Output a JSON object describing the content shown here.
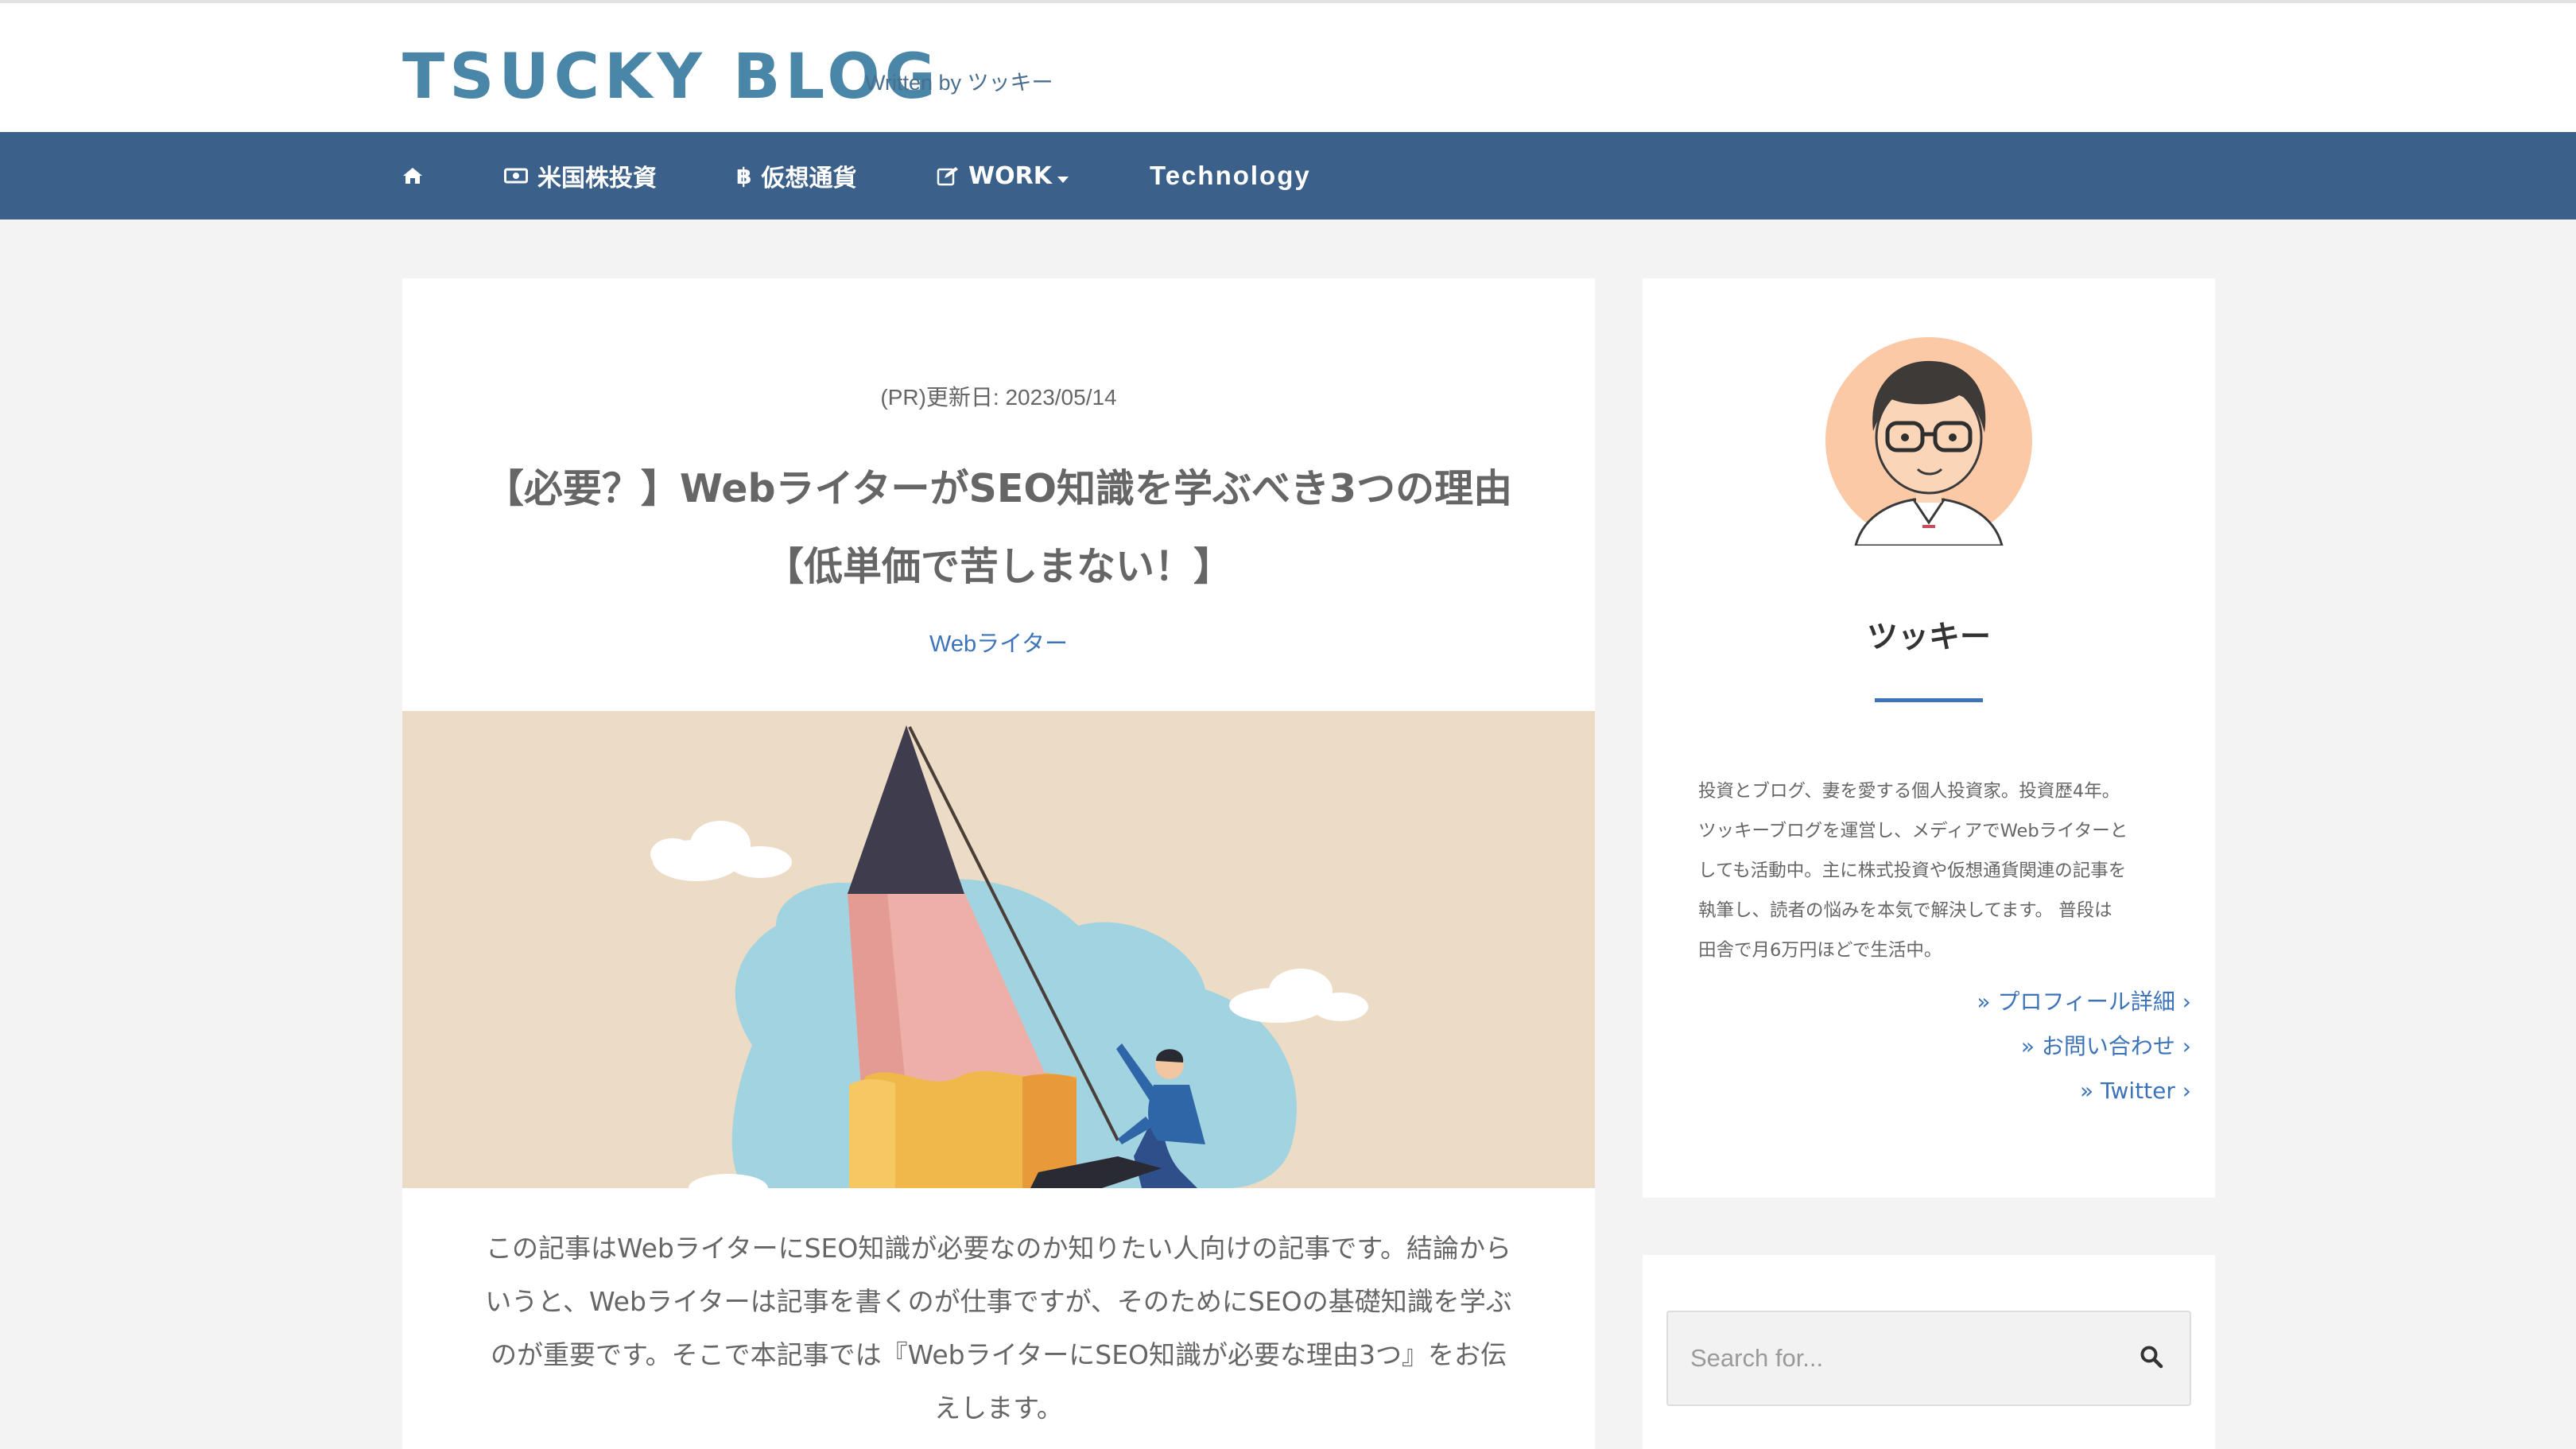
{
  "site": {
    "title": "TSUCKY BLOG",
    "tagline": "Written by ツッキー"
  },
  "nav": {
    "items": [
      {
        "icon": "home-icon",
        "label": ""
      },
      {
        "icon": "money-icon",
        "label": "米国株投資"
      },
      {
        "icon": "bitcoin-icon",
        "label": "仮想通貨"
      },
      {
        "icon": "edit-icon",
        "label": "WORK",
        "dropdown": true
      },
      {
        "icon": "",
        "label": "Technology"
      }
    ]
  },
  "post": {
    "meta": "(PR)更新日: 2023/05/14",
    "title_line1": "【必要？】WebライターがSEO知識を学ぶべき3つの理由",
    "title_line2": "【低単価で苦しまない！】",
    "category": "Webライター",
    "intro_lines": [
      "この記事はWebライターにSEO知識が必要なのか知りたい人向けの記事です。結論から",
      "いうと、Webライターは記事を書くのが仕事ですが、そのためにSEOの基礎知識を学ぶ",
      "のが重要です。そこで本記事では『WebライターにSEO知識が必要な理由3つ』をお伝",
      "えします。"
    ]
  },
  "profile": {
    "name": "ツッキー",
    "description_lines": [
      "投資とブログ、妻を愛する個人投資家。投資歴4年。",
      "ツッキーブログを運営し、メディアでWebライターと",
      "しても活動中。主に株式投資や仮想通貨関連の記事を",
      "執筆し、読者の悩みを本気で解決してます。 普段は",
      "田舎で月6万円ほどで生活中。"
    ],
    "links": [
      {
        "label": "» プロフィール詳細 ›"
      },
      {
        "label": "» お問い合わせ ›"
      },
      {
        "label": "» Twitter ›"
      }
    ]
  },
  "search": {
    "placeholder": "Search for...",
    "value": ""
  },
  "colors": {
    "nav_bg": "#3b608a",
    "accent": "#3d73b9",
    "title": "#4a86a7",
    "page_bg": "#f3f3f3"
  }
}
